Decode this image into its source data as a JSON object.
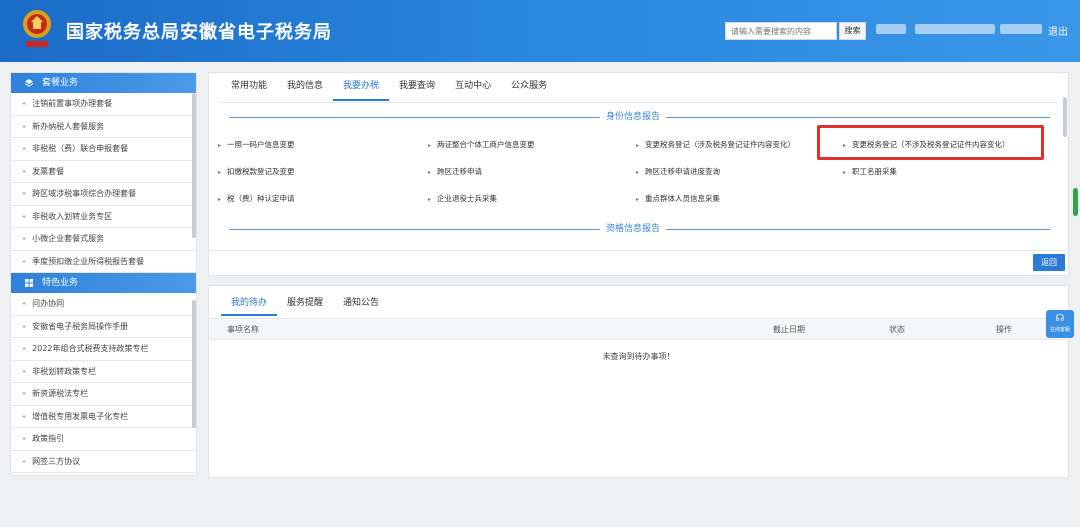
{
  "header": {
    "title": "国家税务总局安徽省电子税务局",
    "search_placeholder": "请输入需要搜索的内容",
    "search_button": "搜索",
    "logout": "退出",
    "logo_text": "中国税务"
  },
  "sidebar": {
    "section1": {
      "title": "套餐业务",
      "items": [
        "注销前置事项办理套餐",
        "新办纳税人套餐服务",
        "非税税（费）联合申报套餐",
        "发票套餐",
        "跨区域涉税事项综合办理套餐",
        "非税收入划转业务专区",
        "小微企业套餐式服务",
        "季度预扣缴企业所得税报告套餐"
      ]
    },
    "section2": {
      "title": "特色业务",
      "items": [
        "问办协同",
        "安徽省电子税务局操作手册",
        "2022年组合式税费支持政策专栏",
        "非税划转政策专栏",
        "新资源税法专栏",
        "增值税专用发票电子化专栏",
        "政策指引",
        "网签三方协议"
      ]
    }
  },
  "main": {
    "tabs": [
      "常用功能",
      "我的信息",
      "我要办税",
      "我要查询",
      "互动中心",
      "公众服务"
    ],
    "active_tab": 2,
    "section1_title": "身份信息报告",
    "section2_title": "资格信息报告",
    "links": [
      "一照一码户信息变更",
      "两证整合个体工商户信息变更",
      "变更税务登记（涉及税务登记证件内容变化）",
      "变更税务登记（不涉及税务登记证件内容变化）",
      "扣缴税款登记及变更",
      "跨区迁移申请",
      "跨区迁移申请进度查询",
      "职工名册采集",
      "税（费）种认定申请",
      "企业退役士兵采集",
      "重点群体人员信息采集"
    ],
    "back_button": "返回"
  },
  "bottom": {
    "tabs": [
      "我的待办",
      "服务提醒",
      "通知公告"
    ],
    "active_tab": 0,
    "columns": [
      "事项名称",
      "截止日期",
      "状态",
      "操作"
    ],
    "empty_message": "未查询到待办事项！"
  },
  "float_service": {
    "label": "在线客服",
    "icon": "headset-icon"
  },
  "colors": {
    "header_blue": "#2a86de",
    "accent": "#2a7ad8",
    "highlight_red": "#e0312b"
  }
}
